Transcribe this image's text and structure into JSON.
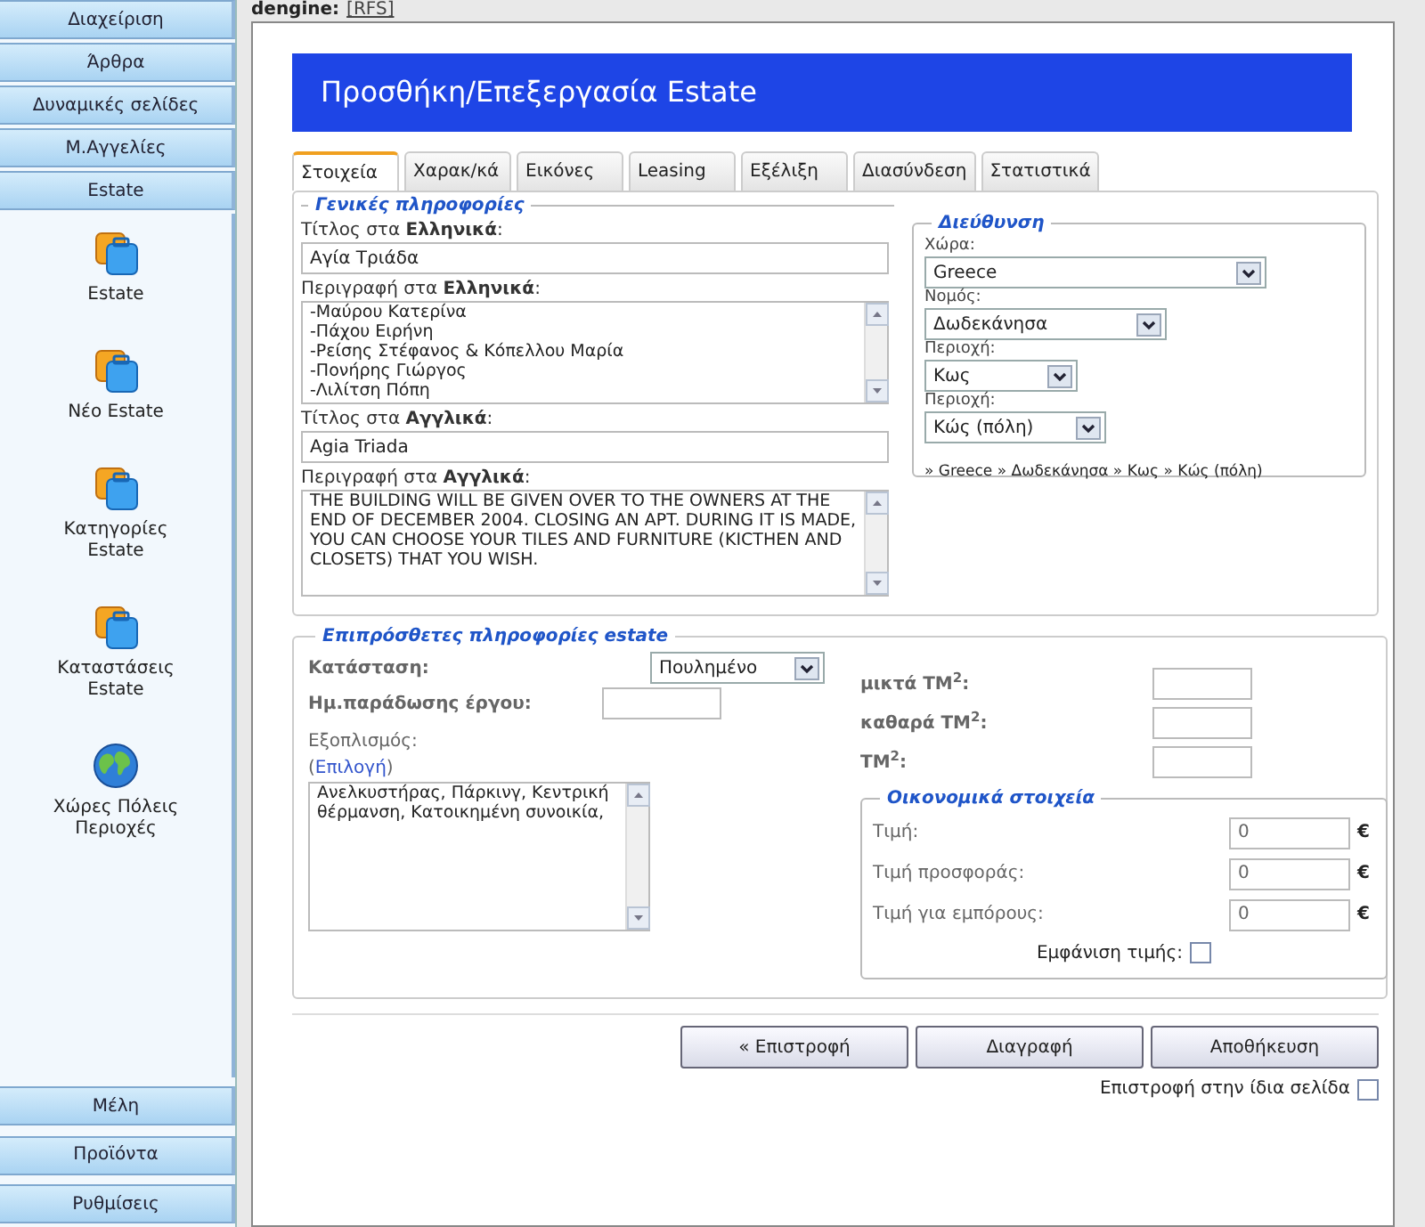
{
  "sidebar": {
    "top_items": [
      {
        "label": "Διαχείριση"
      },
      {
        "label": "Άρθρα"
      },
      {
        "label": "Δυναμικές σελίδες"
      },
      {
        "label": "Μ.Αγγελίες"
      },
      {
        "label": "Estate"
      }
    ],
    "panel_items": [
      {
        "kind": "briefcase",
        "label": "Estate"
      },
      {
        "kind": "briefcase",
        "label": "Νέο Estate"
      },
      {
        "kind": "briefcase",
        "label": "Κατηγορίες Estate"
      },
      {
        "kind": "briefcase",
        "label": "Καταστάσεις Estate"
      },
      {
        "kind": "globe",
        "label": "Χώρες Πόλεις Περιοχές"
      }
    ],
    "bottom_items": [
      {
        "label": "Μέλη"
      },
      {
        "label": "Προϊόντα"
      },
      {
        "label": "Ρυθμίσεις"
      }
    ]
  },
  "breadcrumb": {
    "prefix": "dengine:",
    "link": "[RFS]"
  },
  "header": {
    "title": "Προσθήκη/Επεξεργασία Estate"
  },
  "tabs": [
    {
      "label": "Στοιχεία",
      "selected": true
    },
    {
      "label": "Χαρακ/κά",
      "selected": false
    },
    {
      "label": "Εικόνες",
      "selected": false
    },
    {
      "label": "Leasing",
      "selected": false
    },
    {
      "label": "Εξέλιξη",
      "selected": false
    },
    {
      "label": "Διασύνδεση",
      "selected": false
    },
    {
      "label": "Στατιστικά",
      "selected": false
    }
  ],
  "general": {
    "legend": "Γενικές πληροφορίες",
    "title_gr": {
      "label": "Τίτλος στα **Ελληνικά**:",
      "value": "Αγία Τριάδα"
    },
    "desc_gr": {
      "label": "Περιγραφή στα **Ελληνικά**:",
      "lines": [
        "-Μαύρου Κατερίνα",
        "-Πάχου Ειρήνη",
        "-Ρείσης Στέφανος & Κόπελλου Μαρία",
        "-Πονήρης Γιώργος",
        "-Λιλίτση Πόπη"
      ]
    },
    "title_en": {
      "label": "Τίτλος στα **Αγγλικά**:",
      "value": "Agia Triada"
    },
    "desc_en": {
      "label": "Περιγραφή στα **Αγγλικά**:",
      "lines": [
        "THE BUILDING WILL BE GIVEN OVER TO THE OWNERS AT THE END OF DECEMBER 2004. CLOSING AN APT. DURING IT IS MADE, YOU CAN CHOOSE YOUR TILES AND FURNITURE (KICTHEN AND CLOSETS) THAT YOU WISH."
      ]
    }
  },
  "address": {
    "legend": "Διεύθυνση",
    "selects": [
      {
        "label": "Χώρα:",
        "value": "Greece"
      },
      {
        "label": "Νομός:",
        "value": "Δωδεκάνησα"
      },
      {
        "label": "Περιοχή:",
        "value": "Κως"
      },
      {
        "label": "Περιοχή:",
        "value": "Κώς (πόλη)"
      }
    ],
    "path": "» Greece » Δωδεκάνησα » Κως » Κώς (πόλη)"
  },
  "extra": {
    "legend": "Επιπρόσθετες πληροφορίες estate",
    "status": {
      "label": "Κατάσταση:",
      "value": "Πουλημένο"
    },
    "delivery": {
      "label": "Ημ.παράδωσης έργου:"
    },
    "equipment": {
      "label": "Εξοπλισμός:",
      "before": "(",
      "link": "Επιλογή",
      "after": ")",
      "value": "Ανελκυστήρας, Πάρκινγ, Κεντρική θέρμανση, Κατοικημένη συνοικία,"
    },
    "areas": [
      {
        "label": "μικτά ΤΜ$^{2}$:"
      },
      {
        "label": "καθαρά ΤΜ$^{2}$:"
      },
      {
        "label": "ΤΜ$^{2}$:"
      }
    ],
    "finance": {
      "legend": "Οικονομικά στοιχεία",
      "prices": [
        {
          "label": "Τιμή:",
          "value": "0",
          "unit": "€"
        },
        {
          "label": "Τιμή προσφοράς:",
          "value": "0",
          "unit": "€"
        },
        {
          "label": "Τιμή για εμπόρους:",
          "value": "0",
          "unit": "€"
        }
      ],
      "show_price": {
        "label": "Εμφάνιση τιμής:",
        "checked": false
      }
    }
  },
  "buttons": [
    {
      "label": "« Επιστροφή"
    },
    {
      "label": "Διαγραφή"
    },
    {
      "label": "Αποθήκευση"
    }
  ],
  "return_same_page": {
    "label": "Επιστροφή στην ίδια σελίδα",
    "checked": false
  }
}
